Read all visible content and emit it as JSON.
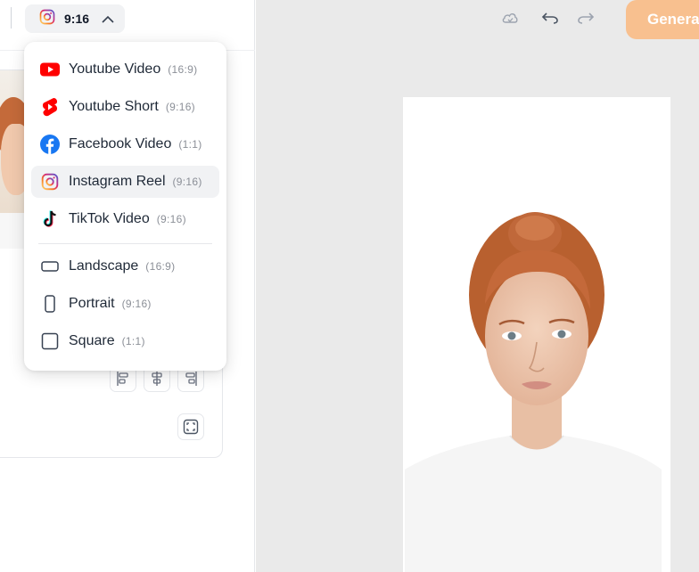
{
  "header": {
    "selected_ratio": "9:16",
    "selected_icon": "instagram-icon"
  },
  "dropdown": {
    "items": [
      {
        "name": "Youtube Video",
        "ratio": "(16:9)",
        "icon": "youtube-icon"
      },
      {
        "name": "Youtube Short",
        "ratio": "(9:16)",
        "icon": "youtube-shorts-icon"
      },
      {
        "name": "Facebook Video",
        "ratio": "(1:1)",
        "icon": "facebook-icon"
      },
      {
        "name": "Instagram Reel",
        "ratio": "(9:16)",
        "icon": "instagram-icon",
        "selected": true
      },
      {
        "name": "TikTok Video",
        "ratio": "(9:16)",
        "icon": "tiktok-icon"
      },
      {
        "name": "Landscape",
        "ratio": "(16:9)",
        "icon": "landscape-icon"
      },
      {
        "name": "Portrait",
        "ratio": "(9:16)",
        "icon": "portrait-icon"
      },
      {
        "name": "Square",
        "ratio": "(1:1)",
        "icon": "square-icon"
      }
    ]
  },
  "toolbar": {
    "generate_label": "Genera"
  },
  "colors": {
    "generate_button": "#f8c08f",
    "canvas_background": "#eaeaea",
    "youtube_red": "#ff0000",
    "facebook_blue": "#1877f2"
  }
}
